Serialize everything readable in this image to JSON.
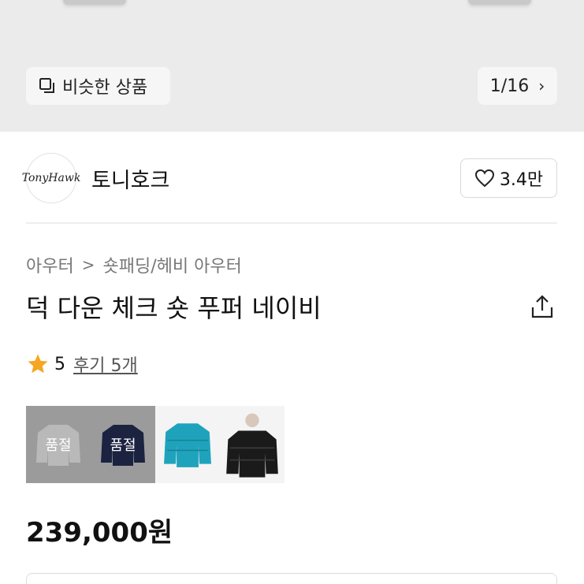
{
  "gallery": {
    "similar_label": "비슷한 상품",
    "counter": "1/16",
    "chevron": "›"
  },
  "brand": {
    "logo_text": "TonyHawk",
    "name": "토니호크",
    "likes": "3.4만"
  },
  "product": {
    "breadcrumb": [
      "아우터",
      "숏패딩/헤비 아우터"
    ],
    "breadcrumb_sep": ">",
    "title": "덕 다운 체크 숏 푸퍼 네이비",
    "rating": "5",
    "reviews_label": "후기 5개",
    "price": "239,000원"
  },
  "options": {
    "swatches": [
      {
        "color": "#b9b9b9",
        "soldout": "품절",
        "selected": true
      },
      {
        "color": "#1b2340",
        "soldout": "품절",
        "selected": true
      },
      {
        "color": "#1fa3bd",
        "soldout": "",
        "selected": false
      },
      {
        "color": "#1a1a1a",
        "soldout": "",
        "selected": false
      }
    ]
  },
  "colors": {
    "star": "#f5a623",
    "hero_bg": "#ebebeb"
  }
}
